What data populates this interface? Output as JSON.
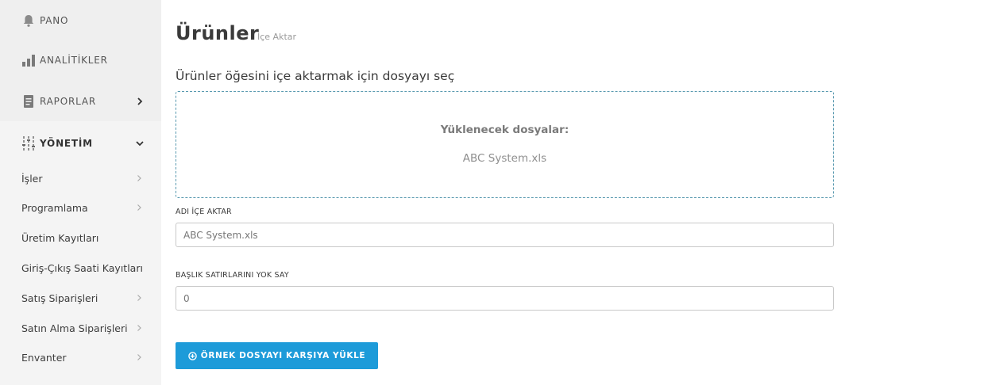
{
  "sidebar": {
    "nav": [
      {
        "label": "PANO",
        "icon": "bell-icon"
      },
      {
        "label": "ANALİTİKLER",
        "icon": "bar-chart-icon"
      },
      {
        "label": "RAPORLAR",
        "icon": "document-icon"
      },
      {
        "label": "YÖNETİM",
        "icon": "sliders-icon"
      }
    ],
    "sub_items": [
      {
        "label": "İşler",
        "has_children": true
      },
      {
        "label": "Programlama",
        "has_children": true
      },
      {
        "label": "Üretim Kayıtları",
        "has_children": false
      },
      {
        "label": "Giriş-Çıkış Saati Kayıtları",
        "has_children": false
      },
      {
        "label": "Satış Siparişleri",
        "has_children": true
      },
      {
        "label": "Satın Alma Siparişleri",
        "has_children": true
      },
      {
        "label": "Envanter",
        "has_children": true
      }
    ]
  },
  "header": {
    "title": "Ürünler",
    "subtitle": "İçe Aktar"
  },
  "main": {
    "section_label": "Ürünler öğesini içe aktarmak için dosyayı seç",
    "dropzone": {
      "heading": "Yüklenecek dosyalar:",
      "file": "ABC System.xls"
    },
    "fields": {
      "import_name": {
        "label": "ADI İÇE AKTAR",
        "value": "ABC System.xls"
      },
      "skip_headers": {
        "label": "BAŞLIK SATIRLARINI YOK SAY",
        "value": "0"
      }
    },
    "upload_button": {
      "label": "ÖRNEK DOSYAYI KARŞIYA YÜKLE",
      "icon": "plus-circle-icon"
    }
  },
  "colors": {
    "accent": "#1d9bd9",
    "dropzone_border": "#5a9ab0",
    "sidebar_bg": "#f4f4f4"
  }
}
